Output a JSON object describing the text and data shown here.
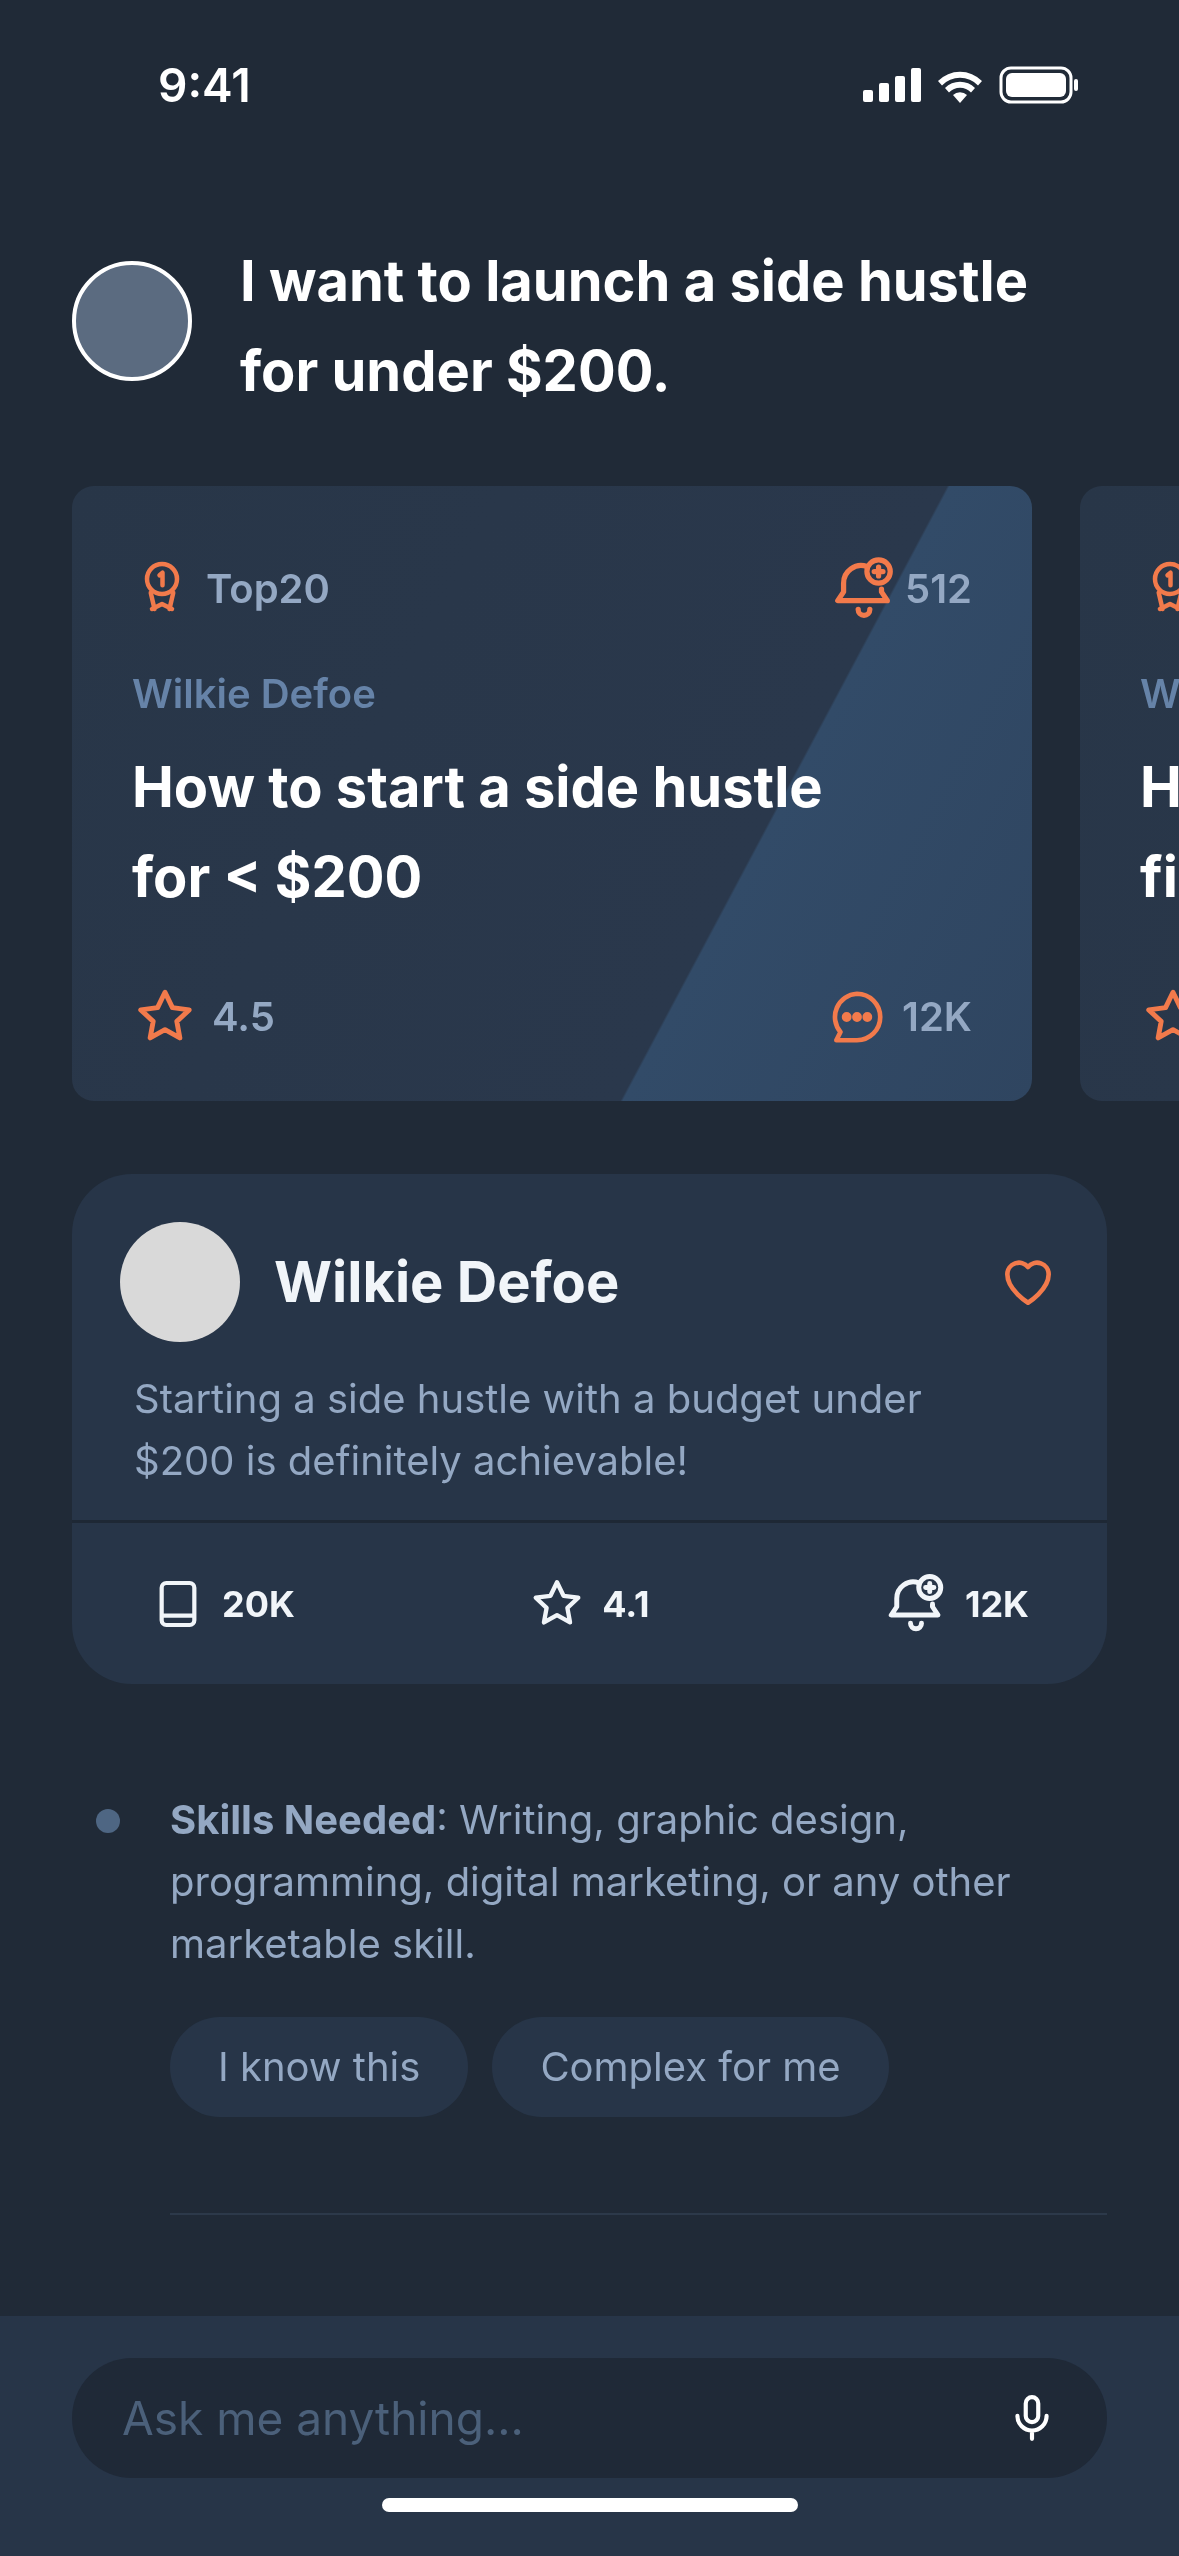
{
  "status_bar": {
    "time": "9:41"
  },
  "prompt": {
    "text": "I want to launch a side hustle for under $200."
  },
  "cards": [
    {
      "badge": "Top20",
      "alerts": "512",
      "author": "Wilkie Defoe",
      "title_lines": [
        "How to start a side hustle",
        "for < $200"
      ],
      "rating": "4.5",
      "comments": "12K"
    },
    {
      "author": "W",
      "title_lines": [
        "H",
        "fi"
      ]
    }
  ],
  "expert": {
    "name": "Wilkie Defoe",
    "liked": false,
    "description": "Starting a side hustle with a budget under $200 is definitely achievable!",
    "stats": [
      {
        "kind": "book",
        "value": "20K"
      },
      {
        "kind": "star",
        "value": "4.1"
      },
      {
        "kind": "bell",
        "value": "12K"
      }
    ]
  },
  "points": [
    {
      "text": "**Skills Needed**: Writing, graphic design, programming, digital marketing, or any other marketable skill.",
      "actions": [
        "I know this",
        "Complex for me"
      ]
    }
  ],
  "composer": {
    "placeholder": "Ask me anything..."
  }
}
